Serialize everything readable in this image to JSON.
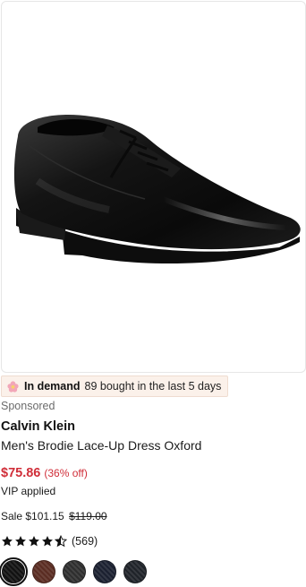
{
  "product": {
    "image_alt": "Men's black leather lace-up oxford dress shoe",
    "demand_badge": {
      "icon": "flower-icon",
      "strong_text": "In demand",
      "rest_text": "89 bought in the last 5 days"
    },
    "sponsored_label": "Sponsored",
    "brand": "Calvin Klein",
    "title": "Men's Brodie Lace-Up Dress Oxford",
    "price": "$75.86",
    "discount": "(36% off)",
    "vip_note": "VIP applied",
    "sale_label": "Sale $101.15",
    "original_price": "$119.00",
    "rating": {
      "stars": 4.5,
      "count_text": "(569)"
    },
    "swatches": [
      {
        "name": "Black",
        "color": "#111111",
        "selected": true
      },
      {
        "name": "Brown",
        "color": "#5a2c22",
        "selected": false
      },
      {
        "name": "Dark Grey",
        "color": "#2e2e2e",
        "selected": false
      },
      {
        "name": "Navy",
        "color": "#1b2030",
        "selected": false
      },
      {
        "name": "Charcoal",
        "color": "#1f2329",
        "selected": false
      }
    ]
  },
  "colors": {
    "sale_red": "#d02e39",
    "badge_bg": "#fbf1ea",
    "star": "#111111"
  }
}
